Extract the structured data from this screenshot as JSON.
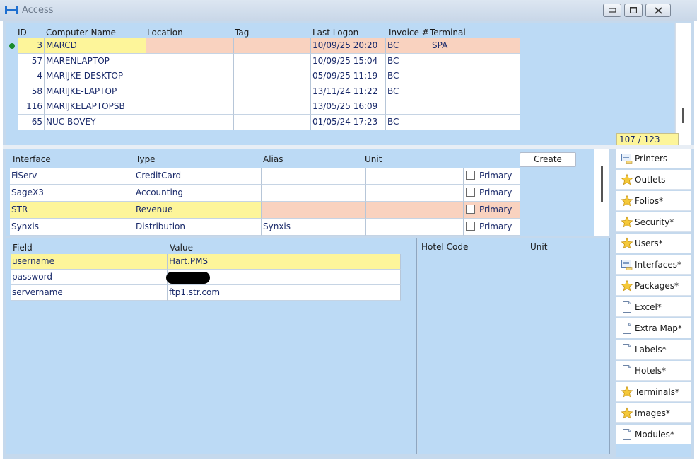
{
  "window": {
    "title": "Access",
    "min_icon": "minimize-icon",
    "max_icon": "maximize-icon",
    "close_icon": "close-icon"
  },
  "computers": {
    "headers": [
      "ID",
      "Computer Name",
      "Location",
      "Tag",
      "Last Logon",
      "Invoice #",
      "Terminal"
    ],
    "rows": [
      {
        "id": "3",
        "name": "MARCD",
        "location": "",
        "tag": "",
        "last_logon": "10/09/25 20:20",
        "invoice": "BC",
        "terminal": "SPA"
      },
      {
        "id": "57",
        "name": "MARENLAPTOP",
        "location": "",
        "tag": "",
        "last_logon": "10/09/25 15:04",
        "invoice": "BC",
        "terminal": ""
      },
      {
        "id": "4",
        "name": "MARIJKE-DESKTOP",
        "location": "",
        "tag": "",
        "last_logon": "05/09/25 11:19",
        "invoice": "BC",
        "terminal": ""
      },
      {
        "id": "58",
        "name": "MARIJKE-LAPTOP",
        "location": "",
        "tag": "",
        "last_logon": "13/11/24 11:22",
        "invoice": "BC",
        "terminal": ""
      },
      {
        "id": "116",
        "name": "MARIJKELAPTOPSB",
        "location": "",
        "tag": "",
        "last_logon": "13/05/25 16:09",
        "invoice": "",
        "terminal": ""
      },
      {
        "id": "65",
        "name": "NUC-BOVEY",
        "location": "",
        "tag": "",
        "last_logon": "01/05/24 17:23",
        "invoice": "BC",
        "terminal": ""
      }
    ],
    "counter": "107 / 123"
  },
  "interfaces": {
    "headers": [
      "Interface",
      "Type",
      "Alias",
      "Unit"
    ],
    "create_label": "Create",
    "rows": [
      {
        "interface": "FiServ",
        "type": "CreditCard",
        "alias": "",
        "unit": "",
        "primary": "Primary"
      },
      {
        "interface": "SageX3",
        "type": "Accounting",
        "alias": "",
        "unit": "",
        "primary": "Primary"
      },
      {
        "interface": "STR",
        "type": "Revenue",
        "alias": "",
        "unit": "",
        "primary": "Primary"
      },
      {
        "interface": "Synxis",
        "type": "Distribution",
        "alias": "Synxis",
        "unit": "",
        "primary": "Primary"
      }
    ]
  },
  "fields": {
    "headers": [
      "Field",
      "Value"
    ],
    "rows": [
      {
        "field": "username",
        "value": "Hart.PMS"
      },
      {
        "field": "password",
        "value": ""
      },
      {
        "field": "servername",
        "value": "ftp1.str.com"
      }
    ]
  },
  "hotel": {
    "headers": [
      "Hotel Code",
      "Unit"
    ]
  },
  "sidenav": {
    "items": [
      {
        "label": "Printers",
        "icon": "monitor-icon"
      },
      {
        "label": "Outlets",
        "icon": "star-icon"
      },
      {
        "label": "Folios*",
        "icon": "star-icon"
      },
      {
        "label": "Security*",
        "icon": "star-icon"
      },
      {
        "label": "Users*",
        "icon": "star-icon"
      },
      {
        "label": "Interfaces*",
        "icon": "monitor-icon"
      },
      {
        "label": "Packages*",
        "icon": "star-icon"
      },
      {
        "label": "Excel*",
        "icon": "page-icon"
      },
      {
        "label": "Extra Map*",
        "icon": "page-icon"
      },
      {
        "label": "Labels*",
        "icon": "page-icon"
      },
      {
        "label": "Hotels*",
        "icon": "page-icon"
      },
      {
        "label": "Terminals*",
        "icon": "star-icon"
      },
      {
        "label": "Images*",
        "icon": "star-icon"
      },
      {
        "label": "Modules*",
        "icon": "page-icon"
      }
    ]
  },
  "colors": {
    "panel": "#bcdaf5",
    "selected_yellow": "#fdf59a",
    "selected_pink": "#f9d2bf",
    "text_blue": "#1a2a6a"
  }
}
